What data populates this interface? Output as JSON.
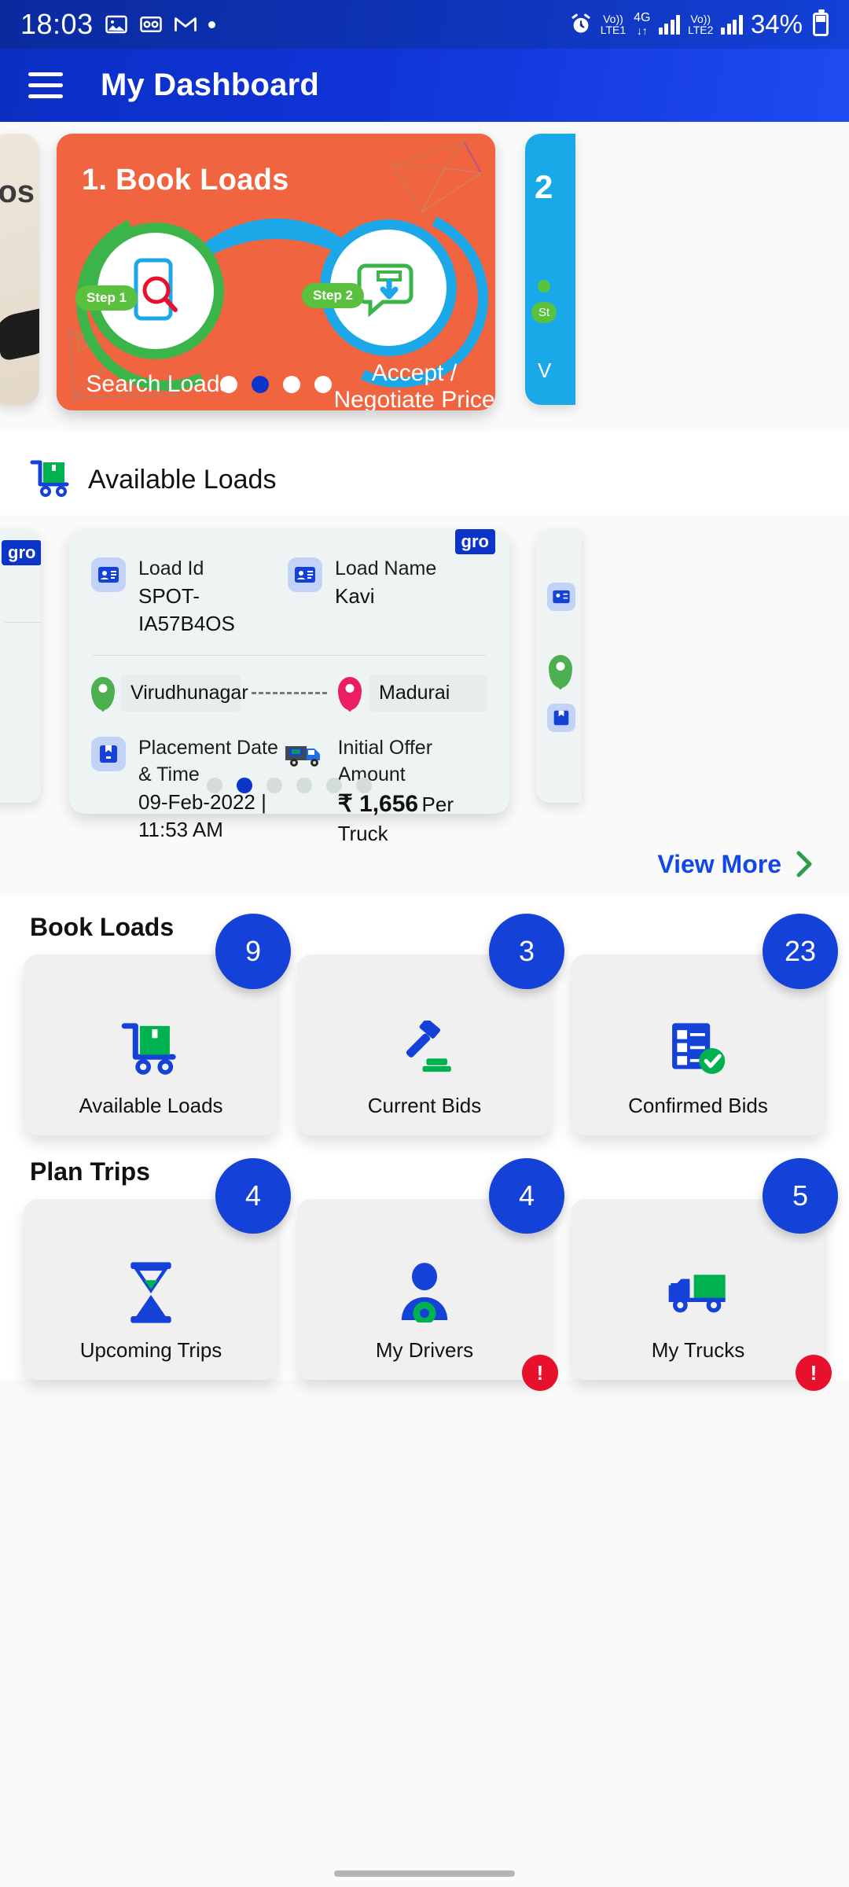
{
  "statusbar": {
    "time": "18:03",
    "icons": [
      "image-icon",
      "voicemail-icon",
      "gmail-icon",
      "dot-icon"
    ],
    "alarm": "alarm-icon",
    "sim1_label": "Vo))",
    "sim1_name": "LTE1",
    "network_type": "4G",
    "sim2_label": "Vo))",
    "sim2_name": "LTE2",
    "battery": "34%"
  },
  "appbar": {
    "menu": "hamburger-menu-icon",
    "title": "My Dashboard"
  },
  "hero": {
    "peek_left_text": "os",
    "card": {
      "title": "1. Book Loads",
      "step1_badge": "Step 1",
      "step2_badge": "Step 2",
      "label1": "Search Loads",
      "label2": "Accept /\nNegotiate Price",
      "label2_line1": "Accept /",
      "label2_line2": "Negotiate Price"
    },
    "peek_right_number": "2",
    "peek_right_badge": "St",
    "peek_right_label": "V",
    "dots_count": 4,
    "dots_active": 1
  },
  "available_loads_section": {
    "icon": "loads-trolley-icon",
    "title": "Available Loads"
  },
  "load_card": {
    "brand_badge": "gro",
    "fields": {
      "load_id_label": "Load Id",
      "load_id_value": "SPOT-IA57B4OS",
      "load_name_label": "Load Name",
      "load_name_value": "Kavi",
      "origin": "Virudhunagar",
      "destination": "Madurai",
      "placement_label": "Placement Date & Time",
      "placement_value": "09-Feb-2022 | 11:53 AM",
      "offer_label": "Initial Offer Amount",
      "offer_value": "₹ 1,656",
      "offer_unit": "Per Truck"
    },
    "dots_count": 6,
    "dots_active": 1
  },
  "view_more": {
    "label": "View More",
    "icon": "chevron-right-icon"
  },
  "book_loads_group": {
    "title": "Book Loads",
    "tiles": [
      {
        "label": "Available Loads",
        "count": "9",
        "icon": "loads-trolley-icon",
        "warning": false
      },
      {
        "label": "Current Bids",
        "count": "3",
        "icon": "gavel-icon",
        "warning": false
      },
      {
        "label": "Confirmed Bids",
        "count": "23",
        "icon": "checklist-check-icon",
        "warning": false
      }
    ]
  },
  "plan_trips_group": {
    "title": "Plan Trips",
    "tiles": [
      {
        "label": "Upcoming Trips",
        "count": "4",
        "icon": "hourglass-icon",
        "warning": false
      },
      {
        "label": "My Drivers",
        "count": "4",
        "icon": "driver-icon",
        "warning": true
      },
      {
        "label": "My Trucks",
        "count": "5",
        "icon": "truck-icon",
        "warning": true
      }
    ],
    "warning_glyph": "!"
  },
  "colors": {
    "status_blue": "#0b2a9e",
    "app_blue": "#1034d8",
    "hero_orange": "#f0643f",
    "accent_green": "#3bb54a",
    "accent_cyan": "#1ba7e8",
    "badge_blue": "#1442d8",
    "link_blue": "#1347e6",
    "warn_red": "#e8112d"
  }
}
